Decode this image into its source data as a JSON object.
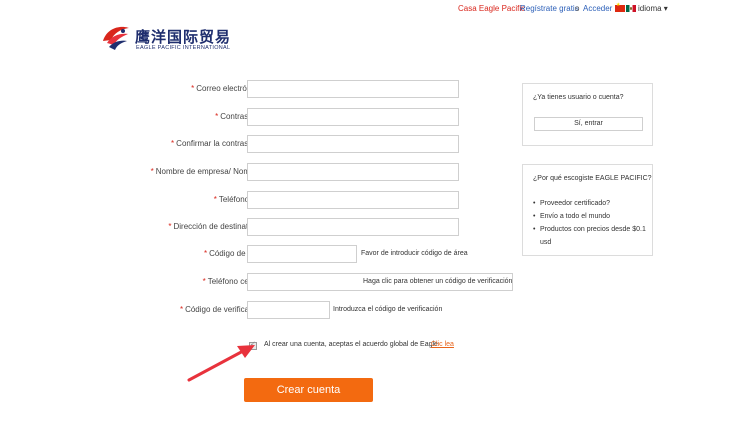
{
  "topbar": {
    "home": "Casa Eagle Pacific",
    "register": "Regístrate gratis",
    "separator": "o",
    "login": "Acceder",
    "language": "idioma ▾"
  },
  "logo": {
    "chinese": "鹰洋国际贸易",
    "english": "EAGLE PACIFIC INTERNATIONAL"
  },
  "form": {
    "required_mark": "*",
    "email_label": "Correo electrónico :",
    "password_label": "Contraseña :",
    "confirm_label": "Confirmar la contraseña :",
    "company_label": "Nombre de empresa/ Nombre :",
    "phone_label": "Teléfono fijo :",
    "address_label": "Dirección de destinatario :",
    "area_label": "Código de área:",
    "area_hint": "Favor de introducir código de área",
    "mobile_label": "Teléfono celular:",
    "send_code": "Haga clic para obtener un código de verificación",
    "code_label": "Código de verificación:",
    "code_hint": "Introduzca el código de verificación",
    "agree_text": "Al crear una cuenta, aceptas el acuerdo global de Eagle",
    "agree_link": "Clic lea",
    "agree_checked": true,
    "submit": "Crear cuenta"
  },
  "sidebar": {
    "account_title": "¿Ya tienes usuario o cuenta?",
    "login_button": "Sí, entrar",
    "why_title": "¿Por qué escogiste EAGLE PACIFIC?",
    "reasons": [
      "Proveedor certificado?",
      "Envío a todo el mundo",
      "Productos con precios desde $0.1 usd"
    ]
  },
  "colors": {
    "accent": "#f36a10",
    "link_red": "#d9261c",
    "link_blue": "#2b5fb8",
    "arrow": "#e8323c"
  }
}
